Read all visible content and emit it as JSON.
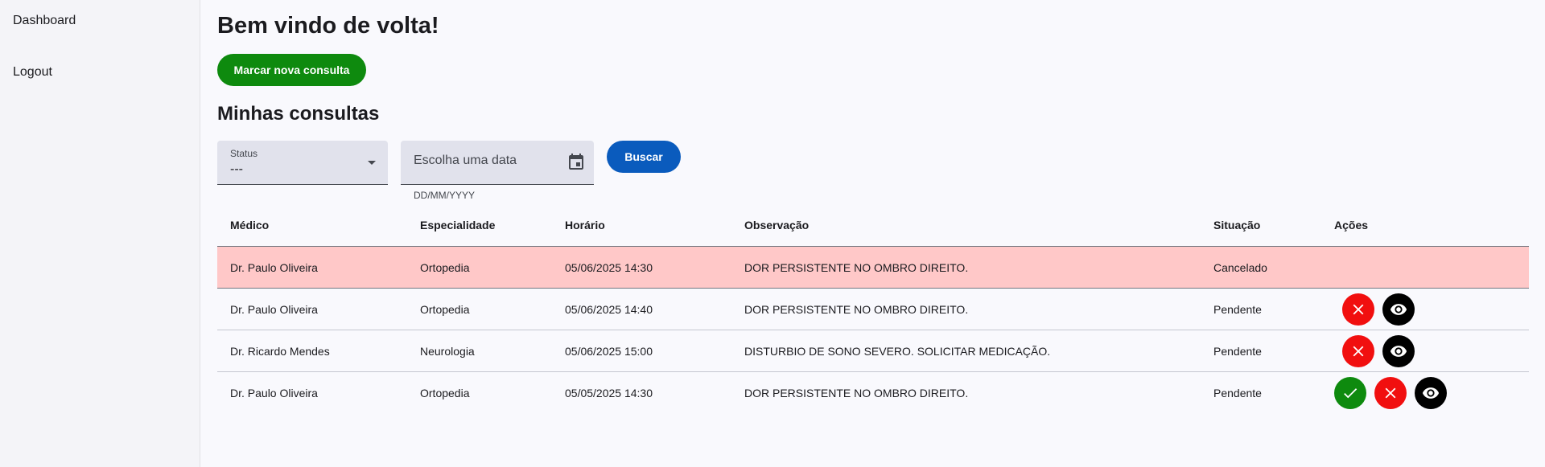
{
  "sidebar": {
    "items": [
      {
        "label": "Dashboard"
      },
      {
        "label": "Logout"
      }
    ]
  },
  "header": {
    "title": "Bem vindo de volta!",
    "new_button": "Marcar nova consulta"
  },
  "section": {
    "title": "Minhas consultas"
  },
  "filters": {
    "status_label": "Status",
    "status_value": "---",
    "date_placeholder": "Escolha uma data",
    "date_hint": "DD/MM/YYYY",
    "search_button": "Buscar"
  },
  "table": {
    "headers": [
      "Médico",
      "Especialidade",
      "Horário",
      "Observação",
      "Situação",
      "Ações"
    ],
    "rows": [
      {
        "medico": "Dr. Paulo Oliveira",
        "especialidade": "Ortopedia",
        "horario": "05/06/2025 14:30",
        "observacao": "DOR PERSISTENTE NO OMBRO DIREITO.",
        "situacao": "Cancelado",
        "actions": []
      },
      {
        "medico": "Dr. Paulo Oliveira",
        "especialidade": "Ortopedia",
        "horario": "05/06/2025 14:40",
        "observacao": "DOR PERSISTENTE NO OMBRO DIREITO.",
        "situacao": "Pendente",
        "actions": [
          "close-icon",
          "eye-icon"
        ]
      },
      {
        "medico": "Dr. Ricardo Mendes",
        "especialidade": "Neurologia",
        "horario": "05/06/2025 15:00",
        "observacao": "DISTURBIO DE SONO SEVERO. SOLICITAR MEDICAÇÃO.",
        "situacao": "Pendente",
        "actions": [
          "close-icon",
          "eye-icon"
        ]
      },
      {
        "medico": "Dr. Paulo Oliveira",
        "especialidade": "Ortopedia",
        "horario": "05/05/2025 14:30",
        "observacao": "DOR PERSISTENTE NO OMBRO DIREITO.",
        "situacao": "Pendente",
        "actions": [
          "check-icon",
          "close-icon",
          "eye-icon"
        ]
      }
    ]
  },
  "colors": {
    "accent_green": "#0e8a0e",
    "accent_blue": "#0a5bbd",
    "danger_red": "#f10f0f",
    "cancelled_row": "#ffc8c8"
  }
}
